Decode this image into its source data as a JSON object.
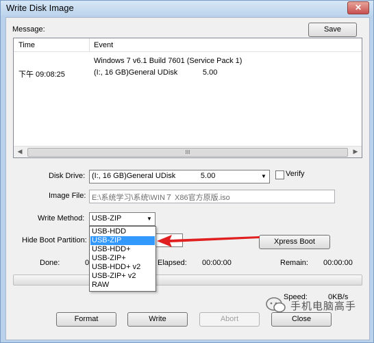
{
  "window": {
    "title": "Write Disk Image",
    "close_glyph": "✕"
  },
  "message": {
    "label": "Message:",
    "save_label": "Save"
  },
  "log": {
    "columns": [
      "Time",
      "Event"
    ],
    "rows": [
      {
        "time": "",
        "event": "Windows 7 v6.1 Build 7601 (Service Pack 1)"
      },
      {
        "time": "下午 09:08:25",
        "event": "(I:, 16 GB)General UDisk            5.00"
      }
    ],
    "scroll_grip": "III"
  },
  "disk_drive": {
    "label": "Disk Drive:",
    "value": "(I:, 16 GB)General UDisk            5.00"
  },
  "verify": {
    "label": "Verify",
    "checked": false
  },
  "image_file": {
    "label": "Image File:",
    "value": "E:\\系统学习\\系统\\WIN７  X86官方原版.iso"
  },
  "write_method": {
    "label": "Write Method:",
    "value": "USB-ZIP",
    "options": [
      "USB-HDD",
      "USB-ZIP",
      "USB-HDD+",
      "USB-ZIP+",
      "USB-HDD+ v2",
      "USB-ZIP+ v2",
      "RAW"
    ],
    "highlighted": "USB-ZIP"
  },
  "hide_boot_partition": {
    "label": "Hide Boot Partition:"
  },
  "xpress_boot": {
    "label": "Xpress Boot"
  },
  "stats": {
    "done_label": "Done:",
    "done_value": "0",
    "elapsed_label": "Elapsed:",
    "elapsed_value": "00:00:00",
    "remain_label": "Remain:",
    "remain_value": "00:00:00",
    "speed_label": "Speed:",
    "speed_value": "0KB/s"
  },
  "buttons": {
    "format": "Format",
    "write": "Write",
    "abort": "Abort",
    "close": "Close"
  },
  "watermark": {
    "text": "手机电脑高手"
  },
  "colors": {
    "accent": "#3399ff",
    "arrow": "#e02020"
  }
}
